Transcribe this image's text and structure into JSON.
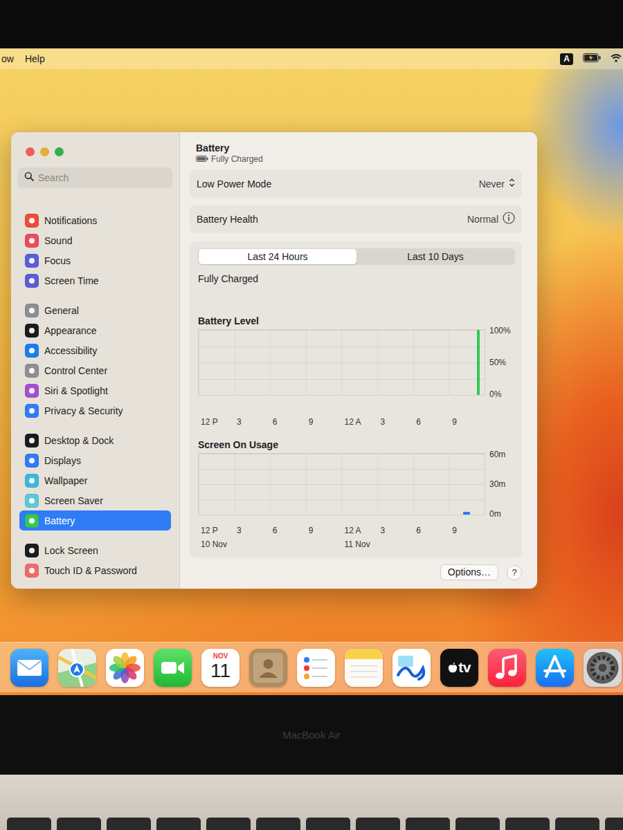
{
  "menubar": {
    "items": [
      "ow",
      "Help"
    ],
    "input_source": "A"
  },
  "window": {
    "title": "Battery",
    "subtitle": "Fully Charged"
  },
  "sidebar": {
    "search": {
      "placeholder": "Search"
    },
    "groups": [
      [
        {
          "label": "Notifications",
          "selected": false,
          "color": "#eb4d3d"
        },
        {
          "label": "Sound",
          "selected": false,
          "color": "#ec4d5c"
        },
        {
          "label": "Focus",
          "selected": false,
          "color": "#5a5fd6"
        },
        {
          "label": "Screen Time",
          "selected": false,
          "color": "#5a5fd6"
        }
      ],
      [
        {
          "label": "General",
          "selected": false,
          "color": "#8e8e93"
        },
        {
          "label": "Appearance",
          "selected": false,
          "color": "#1c1c1e"
        },
        {
          "label": "Accessibility",
          "selected": false,
          "color": "#1a7df0"
        },
        {
          "label": "Control Center",
          "selected": false,
          "color": "#8e8e93"
        },
        {
          "label": "Siri & Spotlight",
          "selected": false,
          "color": "#a54fd2"
        },
        {
          "label": "Privacy & Security",
          "selected": false,
          "color": "#2f7cf6"
        }
      ],
      [
        {
          "label": "Desktop & Dock",
          "selected": false,
          "color": "#1c1c1e"
        },
        {
          "label": "Displays",
          "selected": false,
          "color": "#2f7cf6"
        },
        {
          "label": "Wallpaper",
          "selected": false,
          "color": "#3fb6e0"
        },
        {
          "label": "Screen Saver",
          "selected": false,
          "color": "#5ac8d8"
        },
        {
          "label": "Battery",
          "selected": true,
          "color": "#34c759"
        }
      ],
      [
        {
          "label": "Lock Screen",
          "selected": false,
          "color": "#1c1c1e"
        },
        {
          "label": "Touch ID & Password",
          "selected": false,
          "color": "#ef6b6b"
        }
      ]
    ]
  },
  "settings": [
    {
      "label": "Low Power Mode",
      "value": "Never",
      "kind": "popup"
    },
    {
      "label": "Battery Health",
      "value": "Normal",
      "kind": "info"
    }
  ],
  "tabs": [
    {
      "label": "Last 24 Hours",
      "selected": true
    },
    {
      "label": "Last 10 Days",
      "selected": false
    }
  ],
  "status": "Fully Charged",
  "charts": {
    "battery_level": {
      "title": "Battery Level",
      "y_ticks": [
        "100%",
        "50%",
        "0%"
      ],
      "x_ticks": [
        "12 P",
        "3",
        "6",
        "9",
        "12 A",
        "3",
        "6",
        "9"
      ],
      "values": [
        0,
        0,
        0,
        0,
        0,
        0,
        0,
        0,
        0,
        0,
        0,
        0,
        0,
        0,
        0,
        0,
        0,
        0,
        0,
        0,
        0,
        0,
        0,
        100
      ]
    },
    "screen_on_usage": {
      "title": "Screen On Usage",
      "y_ticks": [
        "60m",
        "30m",
        "0m"
      ],
      "x_ticks": [
        "12 P",
        "3",
        "6",
        "9",
        "12 A",
        "3",
        "6",
        "9"
      ],
      "dates": [
        "10 Nov",
        "11 Nov"
      ],
      "values": [
        0,
        0,
        0,
        0,
        0,
        0,
        0,
        0,
        0,
        0,
        0,
        0,
        0,
        0,
        0,
        0,
        0,
        0,
        0,
        0,
        0,
        0,
        3,
        0
      ]
    }
  },
  "buttons": {
    "options": "Options…",
    "help": "?"
  },
  "dock": {
    "calendar": {
      "month": "NOV",
      "day": "11"
    },
    "tv": "tv"
  },
  "bezel": {
    "label": "MacBook Air"
  }
}
